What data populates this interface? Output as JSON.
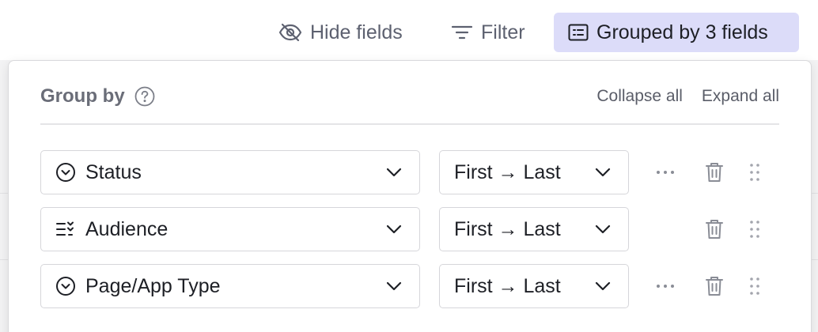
{
  "toolbar": {
    "hide_fields": "Hide fields",
    "filter": "Filter",
    "grouped": "Grouped by 3 fields"
  },
  "panel": {
    "title": "Group by",
    "collapse_all": "Collapse all",
    "expand_all": "Expand all"
  },
  "groups": [
    {
      "field": "Status",
      "field_icon": "single-select-icon",
      "order": "First → Last",
      "has_more": true
    },
    {
      "field": "Audience",
      "field_icon": "multi-select-icon",
      "order": "First → Last",
      "has_more": false
    },
    {
      "field": "Page/App Type",
      "field_icon": "single-select-icon",
      "order": "First → Last",
      "has_more": true
    }
  ],
  "colors": {
    "accent_bg": "#dcdcf9",
    "muted_text": "#5d6170"
  }
}
